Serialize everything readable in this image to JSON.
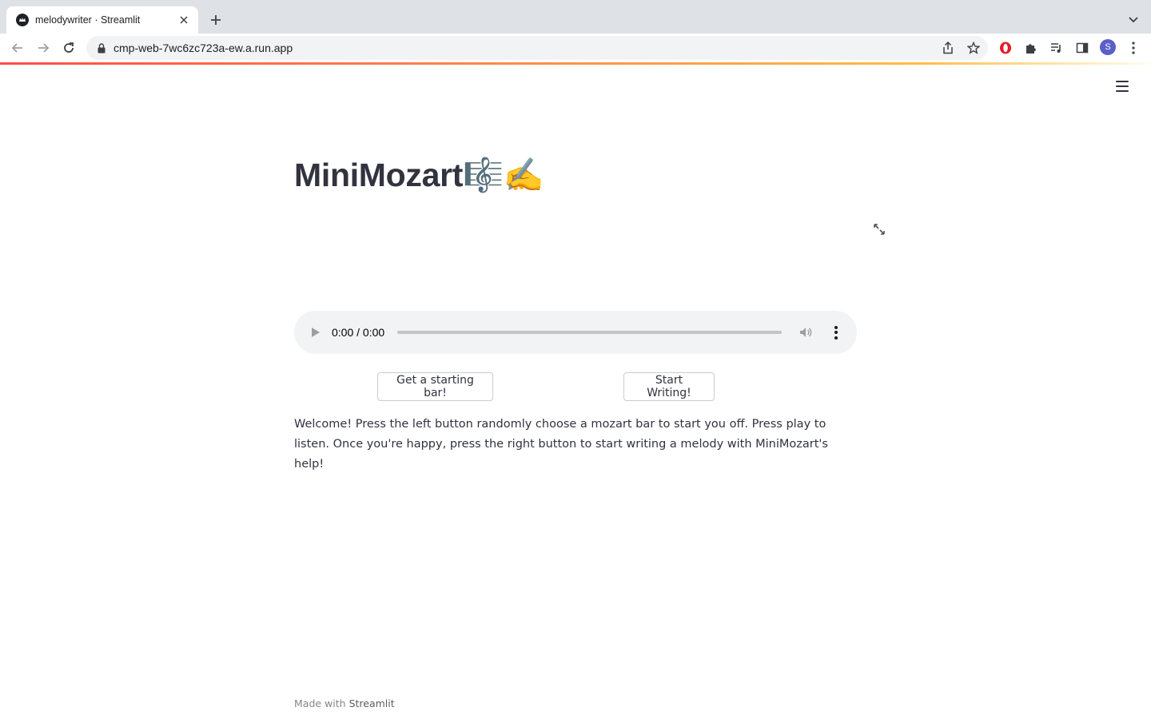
{
  "browser": {
    "tab": {
      "title": "melodywriter · Streamlit"
    },
    "omnibox": {
      "url": "cmp-web-7wc6zc723a-ew.a.run.app"
    },
    "profile": {
      "initial": "S",
      "color": "#5b5fc7"
    }
  },
  "app": {
    "title": "MiniMozart",
    "title_emoji": "🎼✍️",
    "audio": {
      "time": "0:00 / 0:00",
      "progress": 0
    },
    "buttons": {
      "left_label": "Get a starting bar!",
      "right_label": "Start Writing!"
    },
    "welcome_text": "Welcome! Press the left button randomly choose a mozart bar to start you off. Press play to listen. Once you're happy, press the right button to start writing a melody with MiniMozart's help!",
    "footer": {
      "prefix": "Made with",
      "link": "Streamlit"
    },
    "accent_colors": {
      "decoration_start": "#ff4b4b",
      "decoration_end": "#ffbd45",
      "text": "#31333f"
    }
  }
}
